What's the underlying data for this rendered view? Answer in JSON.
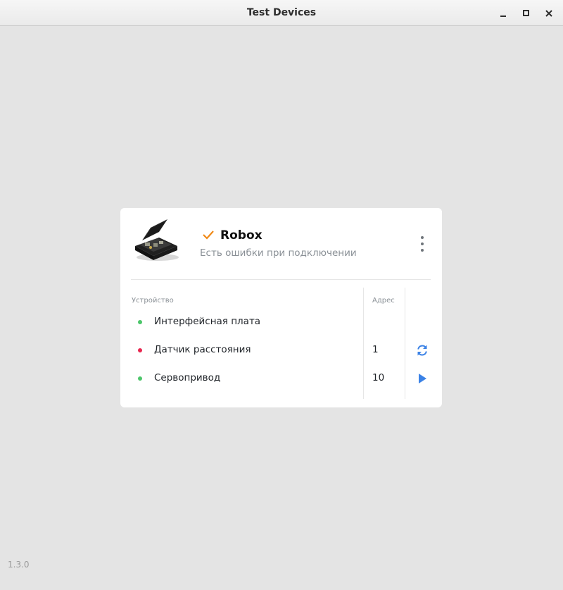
{
  "window": {
    "title": "Test Devices",
    "controls": [
      "minimize-icon",
      "maximize-icon",
      "close-icon"
    ]
  },
  "device": {
    "name": "Robox",
    "status": "Есть ошибки при подключении",
    "status_icon": "check-icon",
    "accent_color": "#f08a18",
    "image": "device-case-image",
    "table": {
      "headers": {
        "device": "Устройство",
        "address": "Адрес"
      },
      "rows": [
        {
          "name": "Интерфейсная плата",
          "address": "",
          "status_color": "#4cc66a",
          "action": ""
        },
        {
          "name": "Датчик расстояния",
          "address": "1",
          "status_color": "#e8264f",
          "action": "refresh-icon"
        },
        {
          "name": "Сервопривод",
          "address": "10",
          "status_color": "#4cc66a",
          "action": "play-icon"
        }
      ]
    },
    "action_color": "#3b82e6"
  },
  "footer": {
    "version": "1.3.0"
  }
}
